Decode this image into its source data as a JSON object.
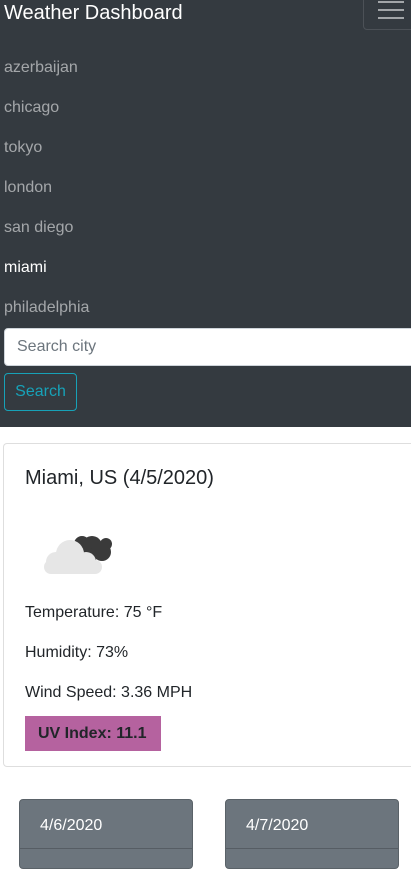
{
  "app": {
    "title": "Weather Dashboard"
  },
  "navbar": {
    "toggler_icon": "hamburger-icon"
  },
  "sidebar": {
    "cities": [
      {
        "label": "azerbaijan",
        "active": false
      },
      {
        "label": "chicago",
        "active": false
      },
      {
        "label": "tokyo",
        "active": false
      },
      {
        "label": "london",
        "active": false
      },
      {
        "label": "san diego",
        "active": false
      },
      {
        "label": "miami",
        "active": true
      },
      {
        "label": "philadelphia",
        "active": false
      }
    ]
  },
  "search": {
    "placeholder": "Search city",
    "value": "",
    "button_label": "Search"
  },
  "current": {
    "title": "Miami, US (4/5/2020)",
    "icon": "partly-cloudy-icon",
    "temperature": "Temperature: 75 °F",
    "humidity": "Humidity: 73%",
    "wind": "Wind Speed: 3.36 MPH",
    "uv": "UV Index: 11.1",
    "uv_color": "#b5629f"
  },
  "forecast": [
    {
      "date": "4/6/2020"
    },
    {
      "date": "4/7/2020"
    }
  ],
  "colors": {
    "navbar": "#343a40",
    "accent": "#17a2b8",
    "forecast_card": "#6c757d"
  }
}
